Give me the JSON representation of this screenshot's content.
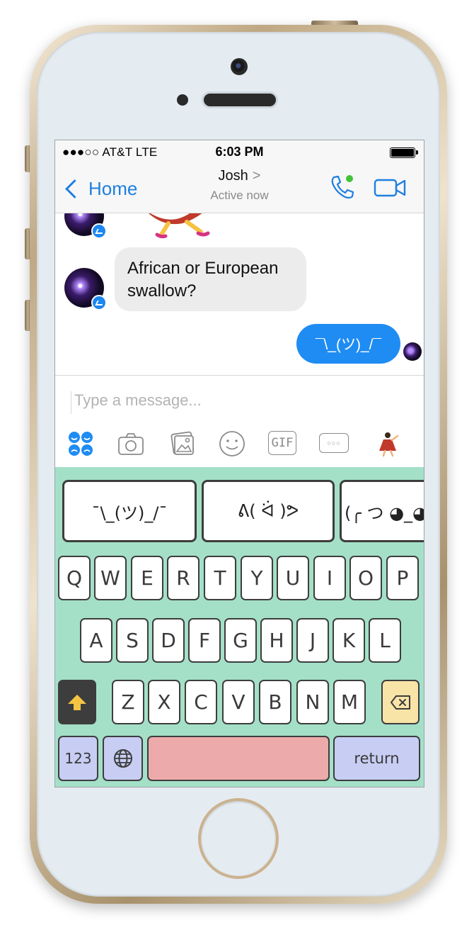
{
  "status_bar": {
    "carrier": "●●●○○ AT&T  LTE",
    "time": "6:03 PM"
  },
  "nav": {
    "back_label": "Home",
    "contact_name": "Josh",
    "contact_arrow": ">",
    "subtitle": "Active now"
  },
  "thread": {
    "incoming_message": "African or European swallow?",
    "outgoing_message": "¯\\_(ツ)_/¯"
  },
  "composer": {
    "placeholder": "Type a message...",
    "tools": [
      "stickers-icon",
      "camera-icon",
      "gallery-icon",
      "emoji-icon",
      "gif-icon",
      "more-icon",
      "dancer-emoji-icon"
    ],
    "gif_label": "GIF",
    "more_label": "○○○"
  },
  "keyboard": {
    "suggestions": [
      "¯\\_(ツ)_/¯",
      "ᕕ( ᐛ )ᕗ",
      "(╭ つ ◕_◕"
    ],
    "row1": [
      "Q",
      "W",
      "E",
      "R",
      "T",
      "Y",
      "U",
      "I",
      "O",
      "P"
    ],
    "row2": [
      "A",
      "S",
      "D",
      "F",
      "G",
      "H",
      "J",
      "K",
      "L"
    ],
    "row3": [
      "Z",
      "X",
      "C",
      "V",
      "B",
      "N",
      "M"
    ],
    "numbers_label": "123",
    "return_label": "return",
    "colors": {
      "background": "#a4e0c8",
      "delete": "#f9e4a8",
      "space": "#ecaaaa",
      "function": "#c7cdf3",
      "shift": "#3d3d3d"
    }
  },
  "colors": {
    "accent": "#1f7fe0",
    "outgoing_bubble": "#1f8cf3",
    "incoming_bubble": "#ececec"
  }
}
